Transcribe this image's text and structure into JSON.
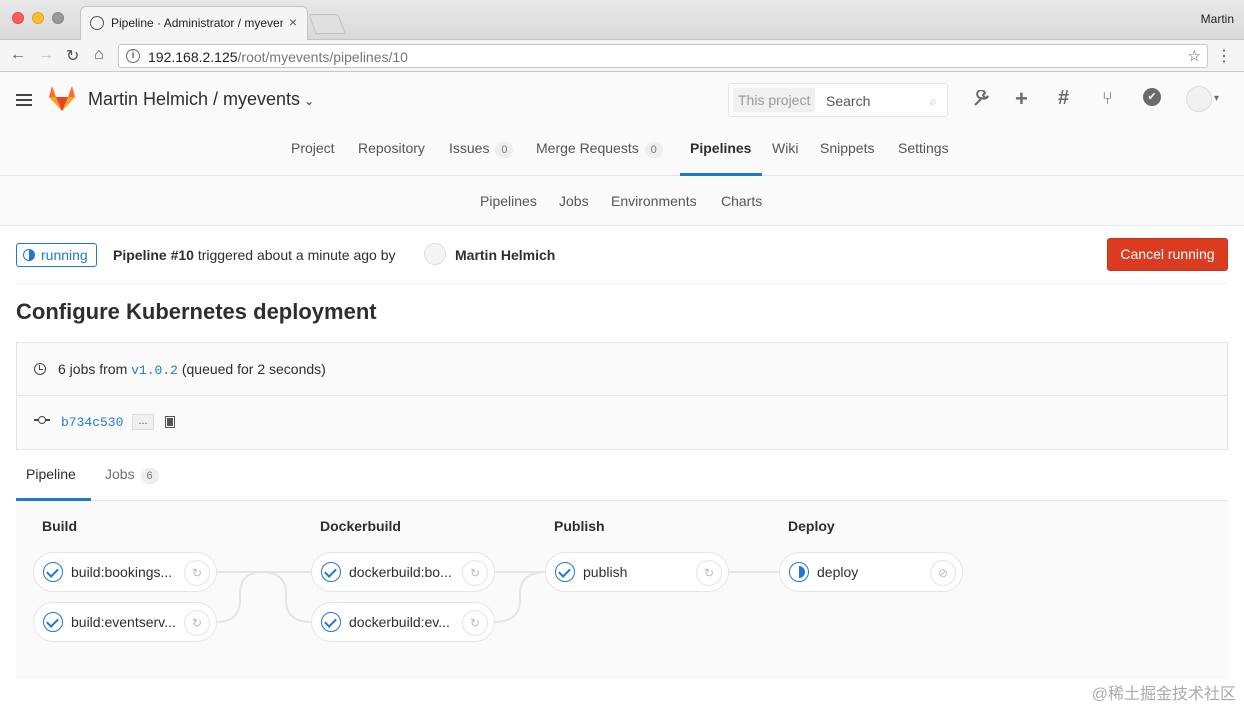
{
  "browser": {
    "tab_title": "Pipeline · Administrator / myevents",
    "tab_close": "×",
    "profile": "Martin",
    "url_host": "192.168.2.125",
    "url_path": "/root/myevents/pipelines/10",
    "back_icon": "←",
    "forward_icon": "→",
    "reload_icon": "↻",
    "home_icon": "⌂",
    "info_icon": "i",
    "star_icon": "☆",
    "menu_icon": "⋮"
  },
  "header": {
    "title": "Martin Helmich / myevents",
    "caret": "⌄",
    "search_scope": "This project",
    "search_placeholder": "Search",
    "search_icon": "⌕",
    "icons": {
      "wrench": "🔧",
      "plus": "+",
      "hash": "#",
      "merge": "⑂",
      "todo": "✔"
    },
    "avatar_caret": "▾"
  },
  "project_nav": {
    "items": [
      {
        "label": "Project"
      },
      {
        "label": "Repository"
      },
      {
        "label": "Issues",
        "count": "0"
      },
      {
        "label": "Merge Requests",
        "count": "0"
      },
      {
        "label": "Pipelines"
      },
      {
        "label": "Wiki"
      },
      {
        "label": "Snippets"
      },
      {
        "label": "Settings"
      }
    ]
  },
  "sub_nav": {
    "items": [
      {
        "label": "Pipelines"
      },
      {
        "label": "Jobs"
      },
      {
        "label": "Environments"
      },
      {
        "label": "Charts"
      }
    ]
  },
  "pipeline": {
    "status": "running",
    "id_label": "Pipeline #10",
    "triggered_text": " triggered about a minute ago by",
    "user": "Martin Helmich",
    "cancel_label": "Cancel running",
    "commit_title": "Configure Kubernetes deployment",
    "jobs_prefix": "6 jobs from ",
    "ref": "v1.0.2",
    "jobs_suffix": " (queued for 2 seconds)",
    "sha": "b734c530",
    "ellipsis": "..."
  },
  "tabs": [
    {
      "label": "Pipeline"
    },
    {
      "label": "Jobs",
      "count": "6"
    }
  ],
  "stages": [
    {
      "title": "Build",
      "jobs": [
        {
          "name": "build:bookings...",
          "status": "success",
          "action": "↻"
        },
        {
          "name": "build:eventserv...",
          "status": "success",
          "action": "↻"
        }
      ]
    },
    {
      "title": "Dockerbuild",
      "jobs": [
        {
          "name": "dockerbuild:bo...",
          "status": "success",
          "action": "↻"
        },
        {
          "name": "dockerbuild:ev...",
          "status": "success",
          "action": "↻"
        }
      ]
    },
    {
      "title": "Publish",
      "jobs": [
        {
          "name": "publish",
          "status": "success",
          "action": "↻"
        }
      ]
    },
    {
      "title": "Deploy",
      "jobs": [
        {
          "name": "deploy",
          "status": "running",
          "action": "⊘"
        }
      ]
    }
  ],
  "colors": {
    "accent": "#1f78d1",
    "danger": "#db3b21",
    "gitlab_orange": "#e24329"
  },
  "watermark": "@稀土掘金技术社区"
}
